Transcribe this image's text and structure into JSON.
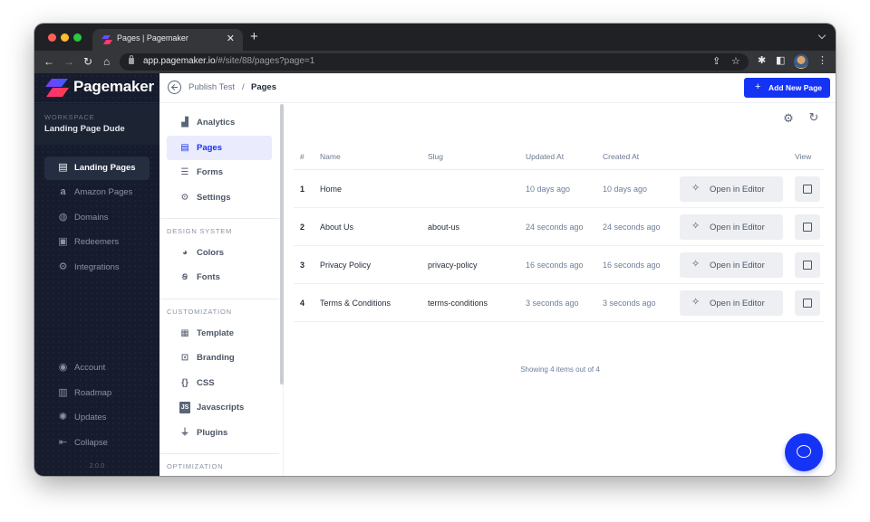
{
  "browser": {
    "tab_title": "Pages | Pagemaker",
    "url_host": "app.pagemaker.io",
    "url_path": "/#/site/88/pages?page=1"
  },
  "sidebar": {
    "brand": "Pagemaker",
    "workspace_label": "WORKSPACE",
    "workspace_name": "Landing Page Dude",
    "items": [
      {
        "label": "Landing Pages",
        "icon": "newspaper-icon",
        "active": true
      },
      {
        "label": "Amazon Pages",
        "icon": "amazon-icon"
      },
      {
        "label": "Domains",
        "icon": "globe-icon"
      },
      {
        "label": "Redeemers",
        "icon": "ticket-icon"
      },
      {
        "label": "Integrations",
        "icon": "cogs-icon"
      }
    ],
    "bottom_items": [
      {
        "label": "Account",
        "icon": "user-circle-icon"
      },
      {
        "label": "Roadmap",
        "icon": "map-icon"
      },
      {
        "label": "Updates",
        "icon": "lightbulb-icon"
      },
      {
        "label": "Collapse",
        "icon": "collapse-left-icon"
      }
    ],
    "version": "2.0.0"
  },
  "breadcrumb": {
    "parent": "Publish Test",
    "separator": "/",
    "current": "Pages"
  },
  "header": {
    "add_button": "Add New Page"
  },
  "submenu": {
    "top_items": [
      {
        "label": "Analytics",
        "icon": "bar-chart-icon"
      },
      {
        "label": "Pages",
        "icon": "document-icon",
        "active": true
      },
      {
        "label": "Forms",
        "icon": "form-icon"
      },
      {
        "label": "Settings",
        "icon": "gear-icon"
      }
    ],
    "sections": [
      {
        "title": "DESIGN SYSTEM",
        "items": [
          {
            "label": "Colors",
            "icon": "palette-icon"
          },
          {
            "label": "Fonts",
            "icon": "font-icon"
          }
        ]
      },
      {
        "title": "CUSTOMIZATION",
        "items": [
          {
            "label": "Template",
            "icon": "template-icon"
          },
          {
            "label": "Branding",
            "icon": "branding-icon"
          },
          {
            "label": "CSS",
            "icon": "braces-icon"
          },
          {
            "label": "Javascripts",
            "icon": "js-icon"
          },
          {
            "label": "Plugins",
            "icon": "plug-icon"
          }
        ]
      },
      {
        "title": "OPTIMIZATION",
        "items": []
      }
    ]
  },
  "table": {
    "columns": [
      "#",
      "Name",
      "Slug",
      "Updated At",
      "Created At",
      "View"
    ],
    "rows": [
      {
        "num": "1",
        "name": "Home",
        "slug": "",
        "updated": "10 days ago",
        "created": "10 days ago"
      },
      {
        "num": "2",
        "name": "About Us",
        "slug": "about-us",
        "updated": "24 seconds ago",
        "created": "24 seconds ago"
      },
      {
        "num": "3",
        "name": "Privacy Policy",
        "slug": "privacy-policy",
        "updated": "16 seconds ago",
        "created": "16 seconds ago"
      },
      {
        "num": "4",
        "name": "Terms & Conditions",
        "slug": "terms-conditions",
        "updated": "3 seconds ago",
        "created": "3 seconds ago"
      }
    ],
    "edit_label": "Open in Editor",
    "footer": "Showing 4 items out of 4"
  },
  "colors": {
    "accent": "#1533f5",
    "sidebar_bg": "#161c2d",
    "active_submenu_bg": "#eaebfd"
  }
}
